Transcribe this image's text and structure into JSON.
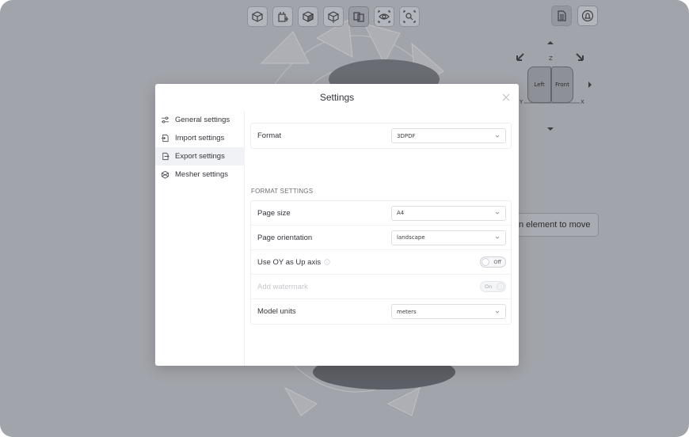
{
  "viewport": {
    "move_hint": "n element to move",
    "view_cube": {
      "left_face": "Left",
      "front_face": "Front",
      "axis_z": "Z",
      "axis_x": "X",
      "axis_y": "Y"
    },
    "toolbar_icons": [
      "box-icon",
      "box-add-icon",
      "box-solid-icon",
      "box-section-icon",
      "layers-icon",
      "view-icon",
      "zoom-fit-icon"
    ],
    "right_icons": [
      "document-icon",
      "bell-icon"
    ]
  },
  "modal": {
    "title": "Settings",
    "sidebar": [
      {
        "label": "General settings",
        "icon": "sliders-icon"
      },
      {
        "label": "Import settings",
        "icon": "import-icon"
      },
      {
        "label": "Export settings",
        "icon": "export-icon",
        "active": true
      },
      {
        "label": "Mesher settings",
        "icon": "mesh-icon"
      }
    ],
    "format": {
      "label": "Format",
      "value": "3DPDF"
    },
    "section_title": "FORMAT SETTINGS",
    "settings": {
      "page_size": {
        "label": "Page size",
        "value": "A4"
      },
      "page_orientation": {
        "label": "Page orientation",
        "value": "landscape"
      },
      "use_oy": {
        "label": "Use OY as Up axis",
        "state": "Off"
      },
      "watermark": {
        "label": "Add watermark",
        "state": "On"
      },
      "model_units": {
        "label": "Model units",
        "value": "meters"
      }
    }
  }
}
